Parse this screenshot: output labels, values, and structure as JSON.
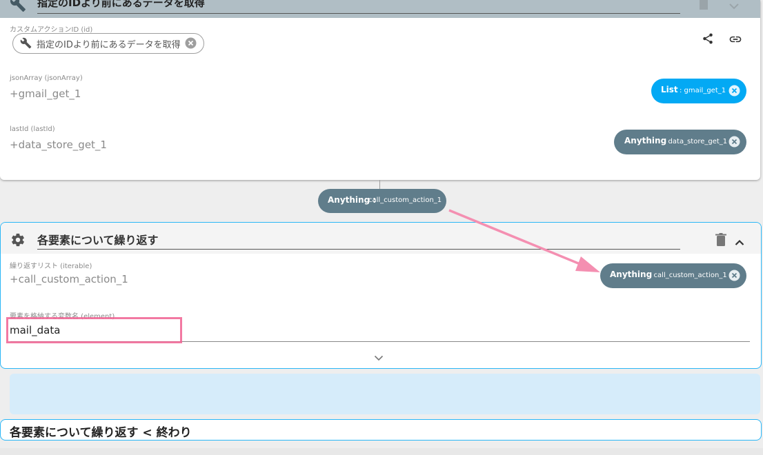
{
  "top_card": {
    "title": "指定のIDより前にあるデータを取得",
    "fields": {
      "custom_action_id": {
        "label": "カスタムアクションID (id)",
        "chip_text": "指定のIDより前にあるデータを取得"
      },
      "json_array": {
        "label": "jsonArray (jsonArray)",
        "value": "+gmail_get_1",
        "chip_type": "List",
        "chip_value": ": gmail_get_1"
      },
      "last_id": {
        "label": "lastId (lastId)",
        "value": "+data_store_get_1",
        "chip_type": "Anything",
        "chip_value": ": data_store_get_1"
      }
    }
  },
  "connector_chip": {
    "type": "Anything :",
    "value": "call_custom_action_1"
  },
  "loop_card": {
    "title": "各要素について繰り返す",
    "iterable": {
      "label": "繰り返すリスト (iterable)",
      "value": "+call_custom_action_1",
      "chip_type": "Anything",
      "chip_value": ": call_custom_action_1"
    },
    "element": {
      "label": "要素を格納する変数名 (element)",
      "value": "mail_data"
    }
  },
  "loop_end": {
    "label": "各要素について繰り返す < 終わり"
  },
  "colors": {
    "list_chip": "#03a9f4",
    "anything_chip": "#607d8b",
    "accent_border": "#29b6f6",
    "annotation": "#f48fb1"
  }
}
